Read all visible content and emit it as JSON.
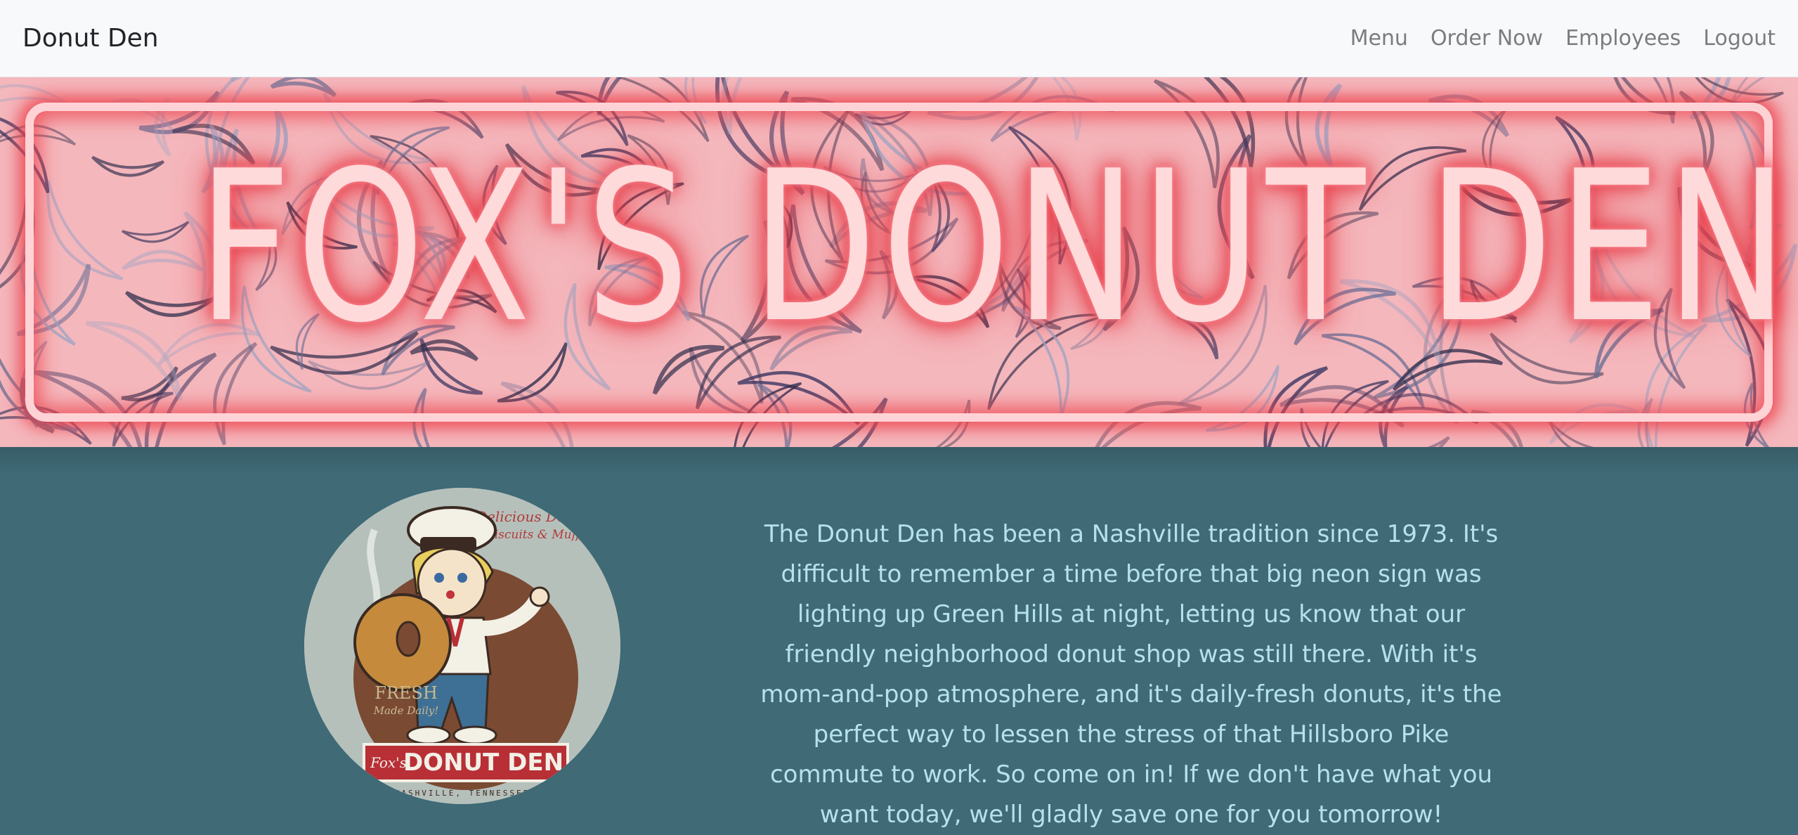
{
  "navbar": {
    "brand": "Donut Den",
    "links": [
      "Menu",
      "Order Now",
      "Employees",
      "Logout"
    ]
  },
  "hero": {
    "sign_text": "FOX'S DONUT DEN"
  },
  "content": {
    "logo": {
      "tagline_line1": "Delicious Donuts",
      "tagline_line2": "Biscuits & Muffins",
      "fresh_line1": "FRESH",
      "fresh_line2": "Made Daily!",
      "banner_script": "Fox's",
      "banner_title": "DONUT DEN",
      "footer": "NASHVILLE, TENNESSEE"
    },
    "about_text": "The Donut Den has been a Nashville tradition since 1973. It's difficult to remember a time before that big neon sign was lighting up Green Hills at night, letting us know that our friendly neighborhood donut shop was still there. With it's mom-and-pop atmosphere, and it's daily-fresh donuts, it's the perfect way to lessen the stress of that Hillsboro Pike commute to work. So come on in! If we don't have what you want today, we'll gladly save one for you tomorrow!"
  },
  "colors": {
    "navbar_bg": "#f8f9fa",
    "content_bg": "#3f6a76",
    "about_text": "#b6e2ee",
    "neon_glow": "#e8414d"
  }
}
